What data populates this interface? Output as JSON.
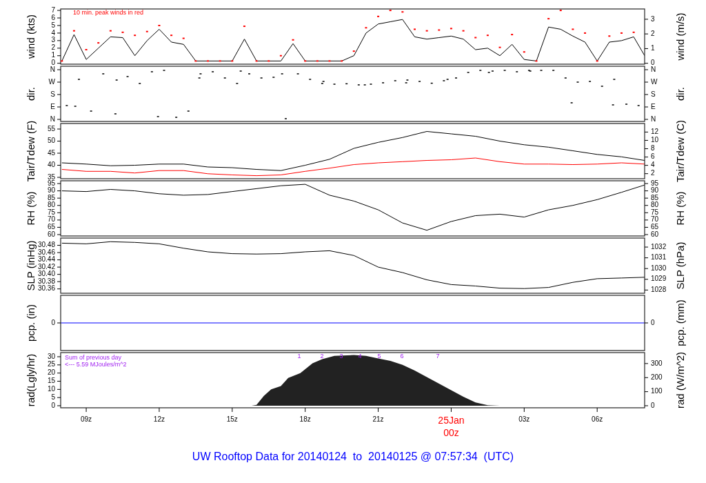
{
  "panels": [
    {
      "chart_data": {
        "type": "line",
        "ylabel": "wind (kts)",
        "y2label": "wind (m/s)",
        "xlim": [
          "2014-01-24T07:57",
          "2014-01-25T07:57"
        ],
        "ylim": [
          -0.12,
          7.19
        ],
        "y2lim": [
          -0.06,
          3.7
        ],
        "yticks": [
          0,
          1,
          2,
          3,
          4,
          5,
          6,
          7
        ],
        "y2ticks": [
          0,
          1,
          2,
          3
        ],
        "x": [
          "2014-01-24T08:00",
          "2014-01-24T08:30",
          "2014-01-24T09:00",
          "2014-01-24T09:30",
          "2014-01-24T10:00",
          "2014-01-24T10:30",
          "2014-01-24T11:00",
          "2014-01-24T11:30",
          "2014-01-24T12:00",
          "2014-01-24T12:30",
          "2014-01-24T13:00",
          "2014-01-24T13:30",
          "2014-01-24T14:00",
          "2014-01-24T14:30",
          "2014-01-24T15:00",
          "2014-01-24T15:30",
          "2014-01-24T16:00",
          "2014-01-24T16:30",
          "2014-01-24T17:00",
          "2014-01-24T17:30",
          "2014-01-24T18:00",
          "2014-01-24T18:30",
          "2014-01-24T19:00",
          "2014-01-24T19:30",
          "2014-01-24T20:00",
          "2014-01-24T20:30",
          "2014-01-24T21:00",
          "2014-01-24T21:30",
          "2014-01-24T22:00",
          "2014-01-24T22:30",
          "2014-01-24T23:00",
          "2014-01-24T23:30",
          "2014-01-25T00:00",
          "2014-01-25T00:30",
          "2014-01-25T01:00",
          "2014-01-25T01:30",
          "2014-01-25T02:00",
          "2014-01-25T02:30",
          "2014-01-25T03:00",
          "2014-01-25T03:30",
          "2014-01-25T04:00",
          "2014-01-25T04:30",
          "2014-01-25T05:00",
          "2014-01-25T05:30",
          "2014-01-25T06:00",
          "2014-01-25T06:30",
          "2014-01-25T07:00",
          "2014-01-25T07:30",
          "2014-01-25T07:57"
        ],
        "series": [
          {
            "color": "#000000",
            "values": [
              0.3,
              3.8,
              0.5,
              2.0,
              3.5,
              3.4,
              1.0,
              3.0,
              4.5,
              2.8,
              2.5,
              0.3,
              0.3,
              0.3,
              0.3,
              3.2,
              0.3,
              0.3,
              0.3,
              2.6,
              0.3,
              0.3,
              0.3,
              0.3,
              1.0,
              4.0,
              5.2,
              5.5,
              5.8,
              3.5,
              3.2,
              3.4,
              3.6,
              3.2,
              1.8,
              2.0,
              1.0,
              2.5,
              0.5,
              0.3,
              4.8,
              4.5,
              3.6,
              2.8,
              0.3,
              2.8,
              3.0,
              3.5,
              1.0
            ]
          }
        ],
        "annotations": [
          "10 min. peak winds in red"
        ]
      },
      "overlay": {
        "chart_data": {
          "type": "scatter",
          "xlim": [
            "2014-01-24T07:57",
            "2014-01-25T07:57"
          ],
          "ylim": [
            -0.12,
            7.19
          ],
          "x": [
            "2014-01-24T08:00",
            "2014-01-24T08:30",
            "2014-01-24T09:00",
            "2014-01-24T09:30",
            "2014-01-24T10:00",
            "2014-01-24T10:30",
            "2014-01-24T11:00",
            "2014-01-24T11:30",
            "2014-01-24T12:00",
            "2014-01-24T12:30",
            "2014-01-24T13:00",
            "2014-01-24T13:30",
            "2014-01-24T14:00",
            "2014-01-24T14:30",
            "2014-01-24T15:00",
            "2014-01-24T15:30",
            "2014-01-24T16:00",
            "2014-01-24T16:30",
            "2014-01-24T17:00",
            "2014-01-24T17:30",
            "2014-01-24T18:00",
            "2014-01-24T18:30",
            "2014-01-24T19:00",
            "2014-01-24T19:30",
            "2014-01-24T20:00",
            "2014-01-24T20:30",
            "2014-01-24T21:00",
            "2014-01-24T21:30",
            "2014-01-24T22:00",
            "2014-01-24T22:30",
            "2014-01-24T23:00",
            "2014-01-24T23:30",
            "2014-01-25T00:00",
            "2014-01-25T00:30",
            "2014-01-25T01:00",
            "2014-01-25T01:30",
            "2014-01-25T02:00",
            "2014-01-25T02:30",
            "2014-01-25T03:00",
            "2014-01-25T03:30",
            "2014-01-25T04:00",
            "2014-01-25T04:30",
            "2014-01-25T05:00",
            "2014-01-25T05:30",
            "2014-01-25T06:00",
            "2014-01-25T06:30",
            "2014-01-25T07:00",
            "2014-01-25T07:30"
          ],
          "series": [
            {
              "color": "#ff0000",
              "values": [
                0.3,
                4.3,
                1.8,
                2.7,
                4.3,
                4.1,
                3.7,
                4.2,
                5.0,
                3.7,
                3.3,
                0.3,
                0.3,
                0.3,
                0.3,
                4.9,
                0.3,
                0.3,
                1.0,
                3.1,
                0.3,
                0.3,
                0.3,
                0.3,
                1.6,
                4.7,
                6.2,
                7.0,
                6.8,
                4.5,
                4.3,
                4.4,
                4.6,
                4.3,
                3.4,
                3.7,
                2.1,
                3.8,
                1.5,
                0.3,
                5.9,
                7.0,
                4.5,
                4.0,
                0.3,
                3.6,
                4.0,
                4.1
              ]
            }
          ]
        }
      }
    },
    {
      "kind": "dots",
      "chart_data": {
        "type": "other",
        "ylabel": "dir.",
        "y2label": "dir.",
        "annotations": [
          "N",
          "E",
          "S",
          "W",
          "N",
          "N",
          "E",
          "S",
          "W",
          "N"
        ]
      }
    },
    {
      "chart_data": {
        "type": "line",
        "ylabel": "Tair/Tdew (F)",
        "y2label": "Tair/Tdew (C)",
        "xlim": [
          "2014-01-24T07:57",
          "2014-01-25T07:57"
        ],
        "ylim": [
          34.43,
          57.29
        ],
        "y2lim": [
          0.79,
          14.05
        ],
        "yticks": [
          35,
          40,
          45,
          50,
          55
        ],
        "y2ticks": [
          2,
          4,
          6,
          8,
          10,
          12
        ],
        "x": [
          "2014-01-24T08:00",
          "2014-01-24T09:00",
          "2014-01-24T10:00",
          "2014-01-24T11:00",
          "2014-01-24T12:00",
          "2014-01-24T13:00",
          "2014-01-24T14:00",
          "2014-01-24T15:00",
          "2014-01-24T16:00",
          "2014-01-24T17:00",
          "2014-01-24T18:00",
          "2014-01-24T19:00",
          "2014-01-24T20:00",
          "2014-01-24T21:00",
          "2014-01-24T22:00",
          "2014-01-24T23:00",
          "2014-01-25T00:00",
          "2014-01-25T01:00",
          "2014-01-25T02:00",
          "2014-01-25T03:00",
          "2014-01-25T04:00",
          "2014-01-25T05:00",
          "2014-01-25T06:00",
          "2014-01-25T07:00",
          "2014-01-25T07:57"
        ],
        "series": [
          {
            "color": "#000000",
            "values": [
              41,
              40.5,
              39.8,
              40,
              40.5,
              40.5,
              39.3,
              39,
              38.3,
              37.8,
              40,
              42.5,
              47,
              49.5,
              51.5,
              54,
              53,
              52,
              50,
              48.5,
              47.5,
              46,
              44.5,
              43.5,
              42
            ]
          },
          {
            "color": "#ff0000",
            "values": [
              38.3,
              37.5,
              37.5,
              36.8,
              37.8,
              37.8,
              36.5,
              36,
              35.7,
              36,
              37.5,
              38.8,
              40.3,
              41,
              41.5,
              42,
              42.3,
              43,
              41.5,
              40.5,
              40.5,
              40.3,
              40.5,
              41,
              40.5
            ]
          }
        ]
      }
    },
    {
      "chart_data": {
        "type": "line",
        "ylabel": "RH (%)",
        "y2label": "RH (%)",
        "xlim": [
          "2014-01-24T07:57",
          "2014-01-25T07:57"
        ],
        "ylim": [
          59.05,
          96.9
        ],
        "y2lim": [
          59.05,
          96.9
        ],
        "yticks": [
          60,
          65,
          70,
          75,
          80,
          85,
          90,
          95
        ],
        "y2ticks": [
          60,
          65,
          70,
          75,
          80,
          85,
          90,
          95
        ],
        "x": [
          "2014-01-24T08:00",
          "2014-01-24T09:00",
          "2014-01-24T10:00",
          "2014-01-24T11:00",
          "2014-01-24T12:00",
          "2014-01-24T13:00",
          "2014-01-24T14:00",
          "2014-01-24T15:00",
          "2014-01-24T16:00",
          "2014-01-24T17:00",
          "2014-01-24T18:00",
          "2014-01-24T19:00",
          "2014-01-24T20:00",
          "2014-01-24T21:00",
          "2014-01-24T22:00",
          "2014-01-24T23:00",
          "2014-01-25T00:00",
          "2014-01-25T01:00",
          "2014-01-25T02:00",
          "2014-01-25T03:00",
          "2014-01-25T04:00",
          "2014-01-25T05:00",
          "2014-01-25T06:00",
          "2014-01-25T07:00",
          "2014-01-25T07:57"
        ],
        "series": [
          {
            "color": "#000000",
            "values": [
              90,
              89.5,
              91,
              90,
              88,
              87,
              87.5,
              89.5,
              91.5,
              93.5,
              94.5,
              87,
              83,
              77,
              68,
              63,
              69,
              73,
              74,
              72,
              77,
              80,
              84,
              89,
              94
            ]
          }
        ]
      }
    },
    {
      "chart_data": {
        "type": "line",
        "ylabel": "SLP (inHg)",
        "y2label": "SLP (hPa)",
        "xlim": [
          "2014-01-24T07:57",
          "2014-01-25T07:57"
        ],
        "ylim": [
          30.348,
          30.5
        ],
        "y2lim": [
          1027.7,
          1032.84
        ],
        "yticks": [
          {
            "value": 30.36,
            "label": "30.36"
          },
          {
            "value": 30.38,
            "label": "30.38"
          },
          {
            "value": 30.4,
            "label": "30.40"
          },
          {
            "value": 30.42,
            "label": "30.42"
          },
          {
            "value": 30.44,
            "label": "30.44"
          },
          {
            "value": 30.46,
            "label": "30.46"
          },
          {
            "value": 30.48,
            "label": "30.48"
          }
        ],
        "y2ticks": [
          1028,
          1029,
          1030,
          1031,
          1032
        ],
        "x": [
          "2014-01-24T08:00",
          "2014-01-24T09:00",
          "2014-01-24T10:00",
          "2014-01-24T11:00",
          "2014-01-24T12:00",
          "2014-01-24T13:00",
          "2014-01-24T14:00",
          "2014-01-24T15:00",
          "2014-01-24T16:00",
          "2014-01-24T17:00",
          "2014-01-24T18:00",
          "2014-01-24T19:00",
          "2014-01-24T20:00",
          "2014-01-24T21:00",
          "2014-01-24T22:00",
          "2014-01-24T23:00",
          "2014-01-25T00:00",
          "2014-01-25T01:00",
          "2014-01-25T02:00",
          "2014-01-25T03:00",
          "2014-01-25T04:00",
          "2014-01-25T05:00",
          "2014-01-25T06:00",
          "2014-01-25T07:00",
          "2014-01-25T07:57"
        ],
        "series": [
          {
            "color": "#000000",
            "values": [
              30.486,
              30.484,
              30.49,
              30.488,
              30.484,
              30.472,
              30.462,
              30.457,
              30.456,
              30.457,
              30.462,
              30.465,
              30.452,
              30.42,
              30.405,
              30.385,
              30.372,
              30.368,
              30.362,
              30.361,
              30.364,
              30.378,
              30.388,
              30.39,
              30.392
            ]
          }
        ]
      }
    },
    {
      "kind": "baseline",
      "chart_data": {
        "type": "other",
        "ylabel": "pcp. (in)",
        "y2label": "pcp. (mm)",
        "annotations": [
          "0",
          "0"
        ]
      }
    },
    {
      "chart_data": {
        "type": "area",
        "ylabel": "rad(Lgly/hr)",
        "y2label": "rad (W/m^2)",
        "xlim": [
          "2014-01-24T07:57",
          "2014-01-25T07:57"
        ],
        "ylim": [
          -1.27,
          32.53
        ],
        "y2lim": [
          -14.7,
          378
        ],
        "yticks": [
          0,
          5,
          10,
          15,
          20,
          25,
          30
        ],
        "y2ticks": [
          0,
          100,
          200,
          300
        ],
        "xticks": [
          {
            "value": "2014-01-24T09:00",
            "label": "09z"
          },
          {
            "value": "2014-01-24T12:00",
            "label": "12z"
          },
          {
            "value": "2014-01-24T15:00",
            "label": "15z"
          },
          {
            "value": "2014-01-24T18:00",
            "label": "18z"
          },
          {
            "value": "2014-01-24T21:00",
            "label": "21z"
          },
          {
            "value": "2014-01-25T00:00",
            "label": "25Jan\n00z"
          },
          {
            "value": "2014-01-25T03:00",
            "label": "03z"
          },
          {
            "value": "2014-01-25T06:00",
            "label": "06z"
          }
        ],
        "x": [
          "2014-01-24T08:00",
          "2014-01-24T15:48",
          "2014-01-24T16:00",
          "2014-01-24T16:18",
          "2014-01-24T16:36",
          "2014-01-24T17:00",
          "2014-01-24T17:18",
          "2014-01-24T17:48",
          "2014-01-24T18:18",
          "2014-01-24T18:42",
          "2014-01-24T19:12",
          "2014-01-24T20:00",
          "2014-01-24T20:30",
          "2014-01-24T21:00",
          "2014-01-24T21:30",
          "2014-01-24T22:00",
          "2014-01-24T22:30",
          "2014-01-24T23:00",
          "2014-01-24T23:30",
          "2014-01-25T00:00",
          "2014-01-25T00:30",
          "2014-01-25T01:00",
          "2014-01-25T01:30",
          "2014-01-25T02:00",
          "2014-01-25T07:54"
        ],
        "series": [
          {
            "color": "#222222",
            "values": [
              0,
              0,
              0.5,
              6,
              10,
              12,
              17,
              20,
              26,
              28.5,
              30.5,
              31,
              30.5,
              29,
              27.5,
              25,
              21.5,
              17.5,
              13.5,
              9.5,
              5.5,
              2,
              0.3,
              0,
              0
            ]
          }
        ],
        "annotations": [
          "Sum of previous day",
          "<--- 5.59 MJoules/m^2"
        ]
      },
      "hour_marks": [
        "1",
        "2",
        "3",
        "4",
        "5",
        "6",
        "7"
      ]
    }
  ],
  "title": "UW Rooftop Data for 20140124  to  20140125 @ 07:57:34  (UTC)"
}
